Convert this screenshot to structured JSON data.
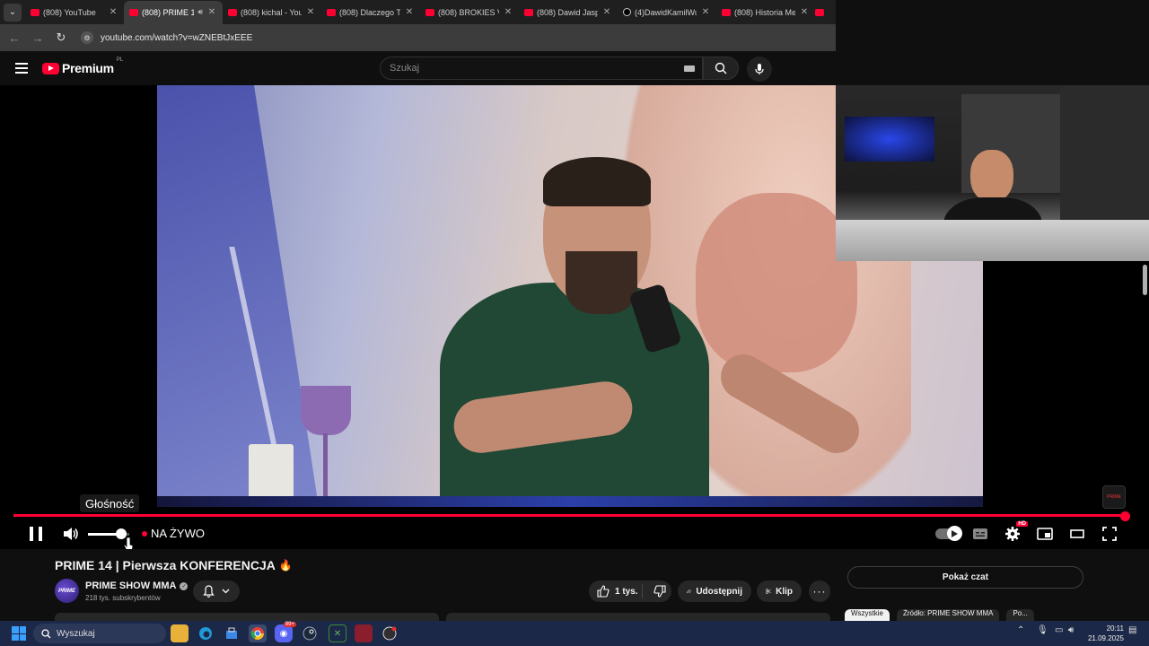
{
  "browser": {
    "tabs": [
      {
        "title": "(808) YouTube",
        "active": false,
        "icon": "youtube-icon"
      },
      {
        "title": "(808) PRIME 1",
        "active": true,
        "icon": "youtube-icon",
        "audio": true
      },
      {
        "title": "(808) kichal - You",
        "active": false,
        "icon": "youtube-icon"
      },
      {
        "title": "(808) Dlaczego Te",
        "active": false,
        "icon": "youtube-icon"
      },
      {
        "title": "(808) BROKIES VS",
        "active": false,
        "icon": "youtube-icon"
      },
      {
        "title": "(808) Dawid Jaspe",
        "active": false,
        "icon": "youtube-icon"
      },
      {
        "title": "(4)DawidKamilWu",
        "active": false,
        "icon": "tiktok-icon"
      },
      {
        "title": "(808) Historia Me",
        "active": false,
        "icon": "youtube-icon"
      }
    ],
    "url": "youtube.com/watch?v=wZNEBtJxEEE"
  },
  "youtube": {
    "logo_text": "Premium",
    "logo_country": "PL",
    "search_placeholder": "Szukaj"
  },
  "player": {
    "tooltip": "Głośność",
    "live_label": "NA ŻYWO",
    "volume": 0.8,
    "progress": 1.0,
    "badge_logo": "PRIME"
  },
  "video": {
    "title": "PRIME 14 | Pierwsza KONFERENCJA",
    "title_emoji": "🔥",
    "channel": "PRIME SHOW MMA",
    "channel_avatar_text": "PRIME",
    "subscribers": "218 tys. subskrybentów",
    "likes": "1 tys.",
    "share_label": "Udostępnij",
    "clip_label": "Klip",
    "show_chat": "Pokaż czat",
    "chips": [
      "Wszystkie",
      "Źródło: PRIME SHOW MMA",
      "Po..."
    ]
  },
  "taskbar": {
    "search_placeholder": "Wyszukaj",
    "discord_badge": "99+",
    "time": "20:11",
    "date": "21.09.2025"
  },
  "colors": {
    "accent": "#ff0033",
    "background": "#0f0f0f",
    "taskbar": "#1c2847"
  }
}
